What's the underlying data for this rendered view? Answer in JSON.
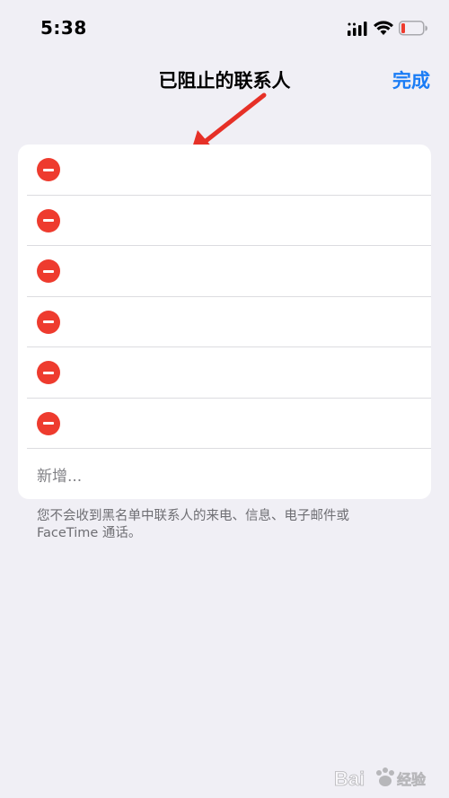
{
  "status_bar": {
    "time": "5:38",
    "icons": [
      "cellular-signal-icon",
      "wifi-icon",
      "battery-low-icon"
    ]
  },
  "nav": {
    "title": "已阻止的联系人",
    "done_label": "完成"
  },
  "blocked_list": {
    "rows": [
      "",
      "",
      "",
      "",
      "",
      ""
    ],
    "add_label": "新增..."
  },
  "footer": {
    "note_line1": "您不会收到黑名单中联系人的来电、信息、电子邮件或",
    "note_line2": "FaceTime 通话。"
  },
  "watermark": {
    "text": "Bai 经验"
  },
  "colors": {
    "background": "#f0eff5",
    "accent": "#1a7cf5",
    "remove_red": "#ee3b2e",
    "annotation_red": "#e63027"
  }
}
